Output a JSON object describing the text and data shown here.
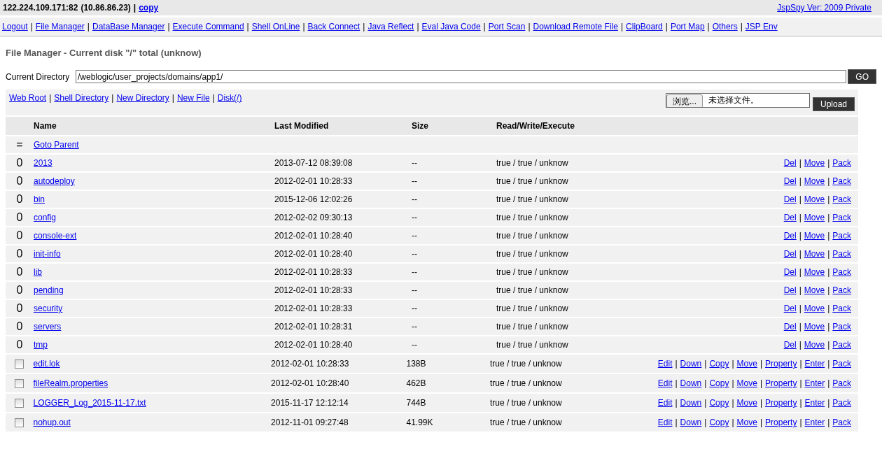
{
  "header": {
    "host": "122.224.109.171:82",
    "ip": "(10.86.86.23)",
    "separator": "|",
    "copy_link": "copy",
    "version_link": "JspSpy Ver: 2009 Private"
  },
  "link_separator": "|",
  "nav": [
    "Logout",
    "File Manager",
    "DataBase Manager",
    "Execute Command",
    "Shell OnLine",
    "Back Connect",
    "Java Reflect",
    "Eval Java Code",
    "Port Scan",
    "Download Remote File",
    "ClipBoard",
    "Port Map",
    "Others",
    "JSP Env"
  ],
  "title": "File Manager - Current disk \"/\" total (unknow)",
  "current_directory": {
    "label": "Current Directory",
    "value": "/weblogic/user_projects/domains/app1/",
    "button": "GO"
  },
  "toolbar": {
    "links": [
      "Web Root",
      "Shell Directory",
      "New Directory",
      "New File",
      "Disk(/)"
    ],
    "browse_button": "浏览...",
    "file_status": "未选择文件。",
    "upload_button": "Upload"
  },
  "table": {
    "columns": [
      "Name",
      "Last Modified",
      "Size",
      "Read/Write/Execute"
    ],
    "parent_row": {
      "marker": "=",
      "link": "Goto Parent"
    },
    "rows": [
      {
        "kind": "dir",
        "marker": "0",
        "name": "2013",
        "modified": "2013-07-12 08:39:08",
        "size": "--",
        "rwx": "true / true / unknow",
        "actions": [
          "Del",
          "Move",
          "Pack"
        ]
      },
      {
        "kind": "dir",
        "marker": "0",
        "name": "autodeploy",
        "modified": "2012-02-01 10:28:33",
        "size": "--",
        "rwx": "true / true / unknow",
        "actions": [
          "Del",
          "Move",
          "Pack"
        ]
      },
      {
        "kind": "dir",
        "marker": "0",
        "name": "bin",
        "modified": "2015-12-06 12:02:26",
        "size": "--",
        "rwx": "true / true / unknow",
        "actions": [
          "Del",
          "Move",
          "Pack"
        ]
      },
      {
        "kind": "dir",
        "marker": "0",
        "name": "config",
        "modified": "2012-02-02 09:30:13",
        "size": "--",
        "rwx": "true / true / unknow",
        "actions": [
          "Del",
          "Move",
          "Pack"
        ]
      },
      {
        "kind": "dir",
        "marker": "0",
        "name": "console-ext",
        "modified": "2012-02-01 10:28:40",
        "size": "--",
        "rwx": "true / true / unknow",
        "actions": [
          "Del",
          "Move",
          "Pack"
        ]
      },
      {
        "kind": "dir",
        "marker": "0",
        "name": "init-info",
        "modified": "2012-02-01 10:28:40",
        "size": "--",
        "rwx": "true / true / unknow",
        "actions": [
          "Del",
          "Move",
          "Pack"
        ]
      },
      {
        "kind": "dir",
        "marker": "0",
        "name": "lib",
        "modified": "2012-02-01 10:28:33",
        "size": "--",
        "rwx": "true / true / unknow",
        "actions": [
          "Del",
          "Move",
          "Pack"
        ]
      },
      {
        "kind": "dir",
        "marker": "0",
        "name": "pending",
        "modified": "2012-02-01 10:28:33",
        "size": "--",
        "rwx": "true / true / unknow",
        "actions": [
          "Del",
          "Move",
          "Pack"
        ]
      },
      {
        "kind": "dir",
        "marker": "0",
        "name": "security",
        "modified": "2012-02-01 10:28:33",
        "size": "--",
        "rwx": "true / true / unknow",
        "actions": [
          "Del",
          "Move",
          "Pack"
        ]
      },
      {
        "kind": "dir",
        "marker": "0",
        "name": "servers",
        "modified": "2012-02-01 10:28:31",
        "size": "--",
        "rwx": "true / true / unknow",
        "actions": [
          "Del",
          "Move",
          "Pack"
        ]
      },
      {
        "kind": "dir",
        "marker": "0",
        "name": "tmp",
        "modified": "2012-02-01 10:28:40",
        "size": "--",
        "rwx": "true / true / unknow",
        "actions": [
          "Del",
          "Move",
          "Pack"
        ]
      },
      {
        "kind": "file",
        "checked": false,
        "name": "edit.lok",
        "modified": "2012-02-01 10:28:33",
        "size": "138B",
        "rwx": "true / true / unknow",
        "actions": [
          "Edit",
          "Down",
          "Copy",
          "Move",
          "Property",
          "Enter",
          "Pack"
        ]
      },
      {
        "kind": "file",
        "checked": false,
        "name": "fileRealm.properties",
        "modified": "2012-02-01 10:28:40",
        "size": "462B",
        "rwx": "true / true / unknow",
        "actions": [
          "Edit",
          "Down",
          "Copy",
          "Move",
          "Property",
          "Enter",
          "Pack"
        ]
      },
      {
        "kind": "file",
        "checked": false,
        "name": "LOGGER_Log_2015-11-17.txt",
        "modified": "2015-11-17 12:12:14",
        "size": "744B",
        "rwx": "true / true / unknow",
        "actions": [
          "Edit",
          "Down",
          "Copy",
          "Move",
          "Property",
          "Enter",
          "Pack"
        ]
      },
      {
        "kind": "file",
        "checked": false,
        "name": "nohup.out",
        "modified": "2012-11-01 09:27:48",
        "size": "41.99K",
        "rwx": "true / true / unknow",
        "actions": [
          "Edit",
          "Down",
          "Copy",
          "Move",
          "Property",
          "Enter",
          "Pack"
        ]
      }
    ]
  }
}
